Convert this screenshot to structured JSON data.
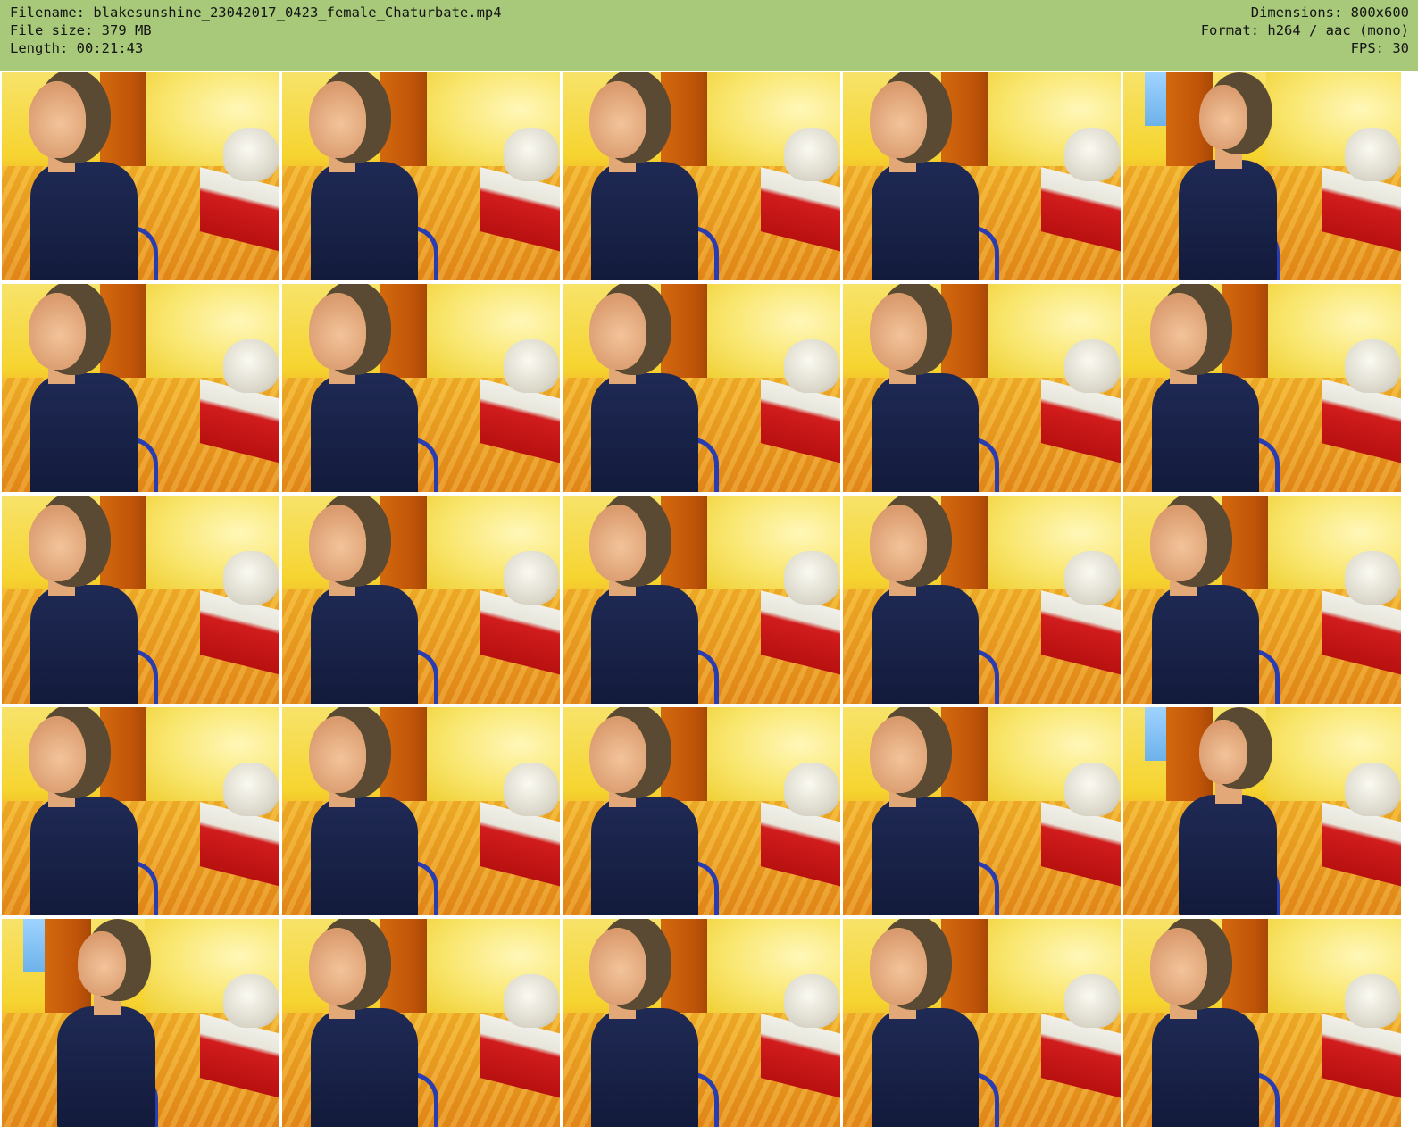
{
  "header": {
    "left": [
      "Filename: blakesunshine_23042017_0423_female_Chaturbate.mp4",
      "File size: 379 MB",
      "Length: 00:21:43"
    ],
    "right": [
      "Dimensions: 800x600",
      "Format: h264 / aac (mono)",
      "FPS: 30"
    ]
  },
  "colors": {
    "header_background": "#a8c97a",
    "page_background": "#ffffff"
  },
  "thumbnails": {
    "rows": 5,
    "columns": 5,
    "count": 25
  }
}
